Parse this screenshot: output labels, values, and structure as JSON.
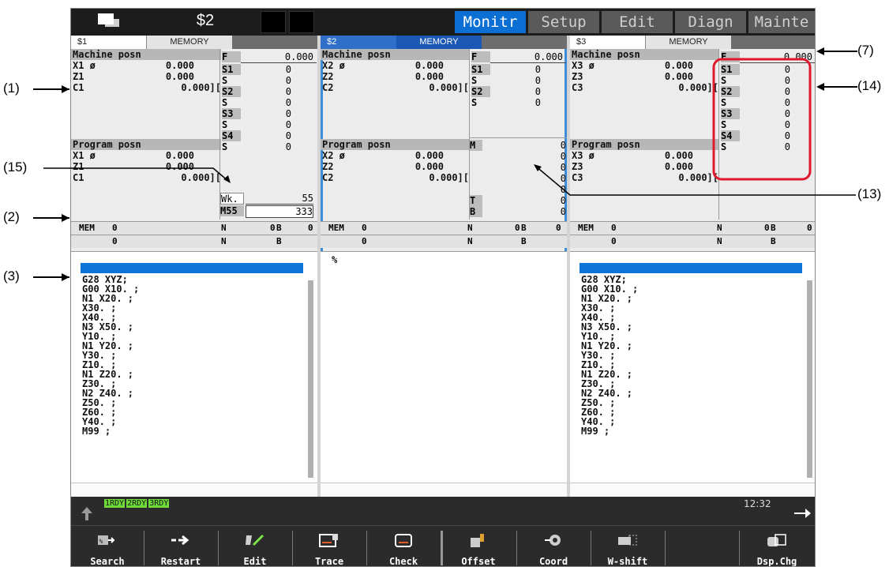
{
  "topbar": {
    "title": "$2",
    "tabs": [
      {
        "label": "Monitr",
        "active": true
      },
      {
        "label": "Setup",
        "active": false
      },
      {
        "label": "Edit",
        "active": false
      },
      {
        "label": "Diagn",
        "active": false
      },
      {
        "label": "Mainte",
        "active": false
      }
    ]
  },
  "panels": [
    {
      "system": "$1",
      "mode": "MEMORY",
      "machine_title": "Machine posn",
      "machine_axes": [
        {
          "name": "X1 ø",
          "value": "0.000"
        },
        {
          "name": "Z1",
          "value": "0.000"
        },
        {
          "name": "C1",
          "value": "0.000]["
        }
      ],
      "program_title": "Program posn",
      "program_axes": [
        {
          "name": "X1 ø",
          "value": "0.000"
        },
        {
          "name": "Z1",
          "value": "0.000"
        },
        {
          "name": "C1",
          "value": "0.000]["
        }
      ],
      "feed_label": "F",
      "feed_value": "0.000",
      "spindle": [
        {
          "label": "S1",
          "value": "0"
        },
        {
          "label": "S",
          "value": "0"
        },
        {
          "label": "S2",
          "value": "0"
        },
        {
          "label": "S",
          "value": "0"
        },
        {
          "label": "S3",
          "value": "0"
        },
        {
          "label": "S",
          "value": "0"
        },
        {
          "label": "S4",
          "value": "0"
        },
        {
          "label": "S",
          "value": "0"
        }
      ],
      "wk_label": "Wk.",
      "wk_value": "55",
      "m_label": "M55",
      "m_value": "333",
      "status": {
        "mode": "MEM",
        "o1": "0",
        "n1": "N",
        "num1": "0",
        "b1": "B",
        "bnum1": "0",
        "o2": "0",
        "n2": "N",
        "b2": "B"
      },
      "program_lines": [
        "G28 XYZ;",
        "G00 X10. ;",
        "N1 X20. ;",
        "X30. ;",
        "X40. ;",
        "N3 X50. ;",
        "Y10. ;",
        "N1 Y20. ;",
        "Y30. ;",
        "Z10. ;",
        "N1 Z20. ;",
        "Z30. ;",
        "N2 Z40. ;",
        "Z50. ;",
        "Z60. ;",
        "Y40. ;",
        "M99 ;"
      ]
    },
    {
      "system": "$2",
      "mode": "MEMORY",
      "machine_title": "Machine posn",
      "machine_axes": [
        {
          "name": "X2 ø",
          "value": "0.000"
        },
        {
          "name": "Z2",
          "value": "0.000"
        },
        {
          "name": "C2",
          "value": "0.000]["
        }
      ],
      "program_title": "Program posn",
      "program_axes": [
        {
          "name": "X2 ø",
          "value": "0.000"
        },
        {
          "name": "Z2",
          "value": "0.000"
        },
        {
          "name": "C2",
          "value": "0.000]["
        }
      ],
      "feed_label": "F",
      "feed_value": "0.000",
      "spindle": [
        {
          "label": "S1",
          "value": "0"
        },
        {
          "label": "S",
          "value": "0"
        },
        {
          "label": "S2",
          "value": "0"
        },
        {
          "label": "S",
          "value": "0"
        }
      ],
      "mtb": [
        {
          "label": "M",
          "value": "0"
        },
        {
          "label": "",
          "value": "0"
        },
        {
          "label": "",
          "value": "0"
        },
        {
          "label": "",
          "value": "0"
        },
        {
          "label": "",
          "value": "0"
        },
        {
          "label": "T",
          "value": "0"
        },
        {
          "label": "B",
          "value": "0"
        }
      ],
      "status": {
        "mode": "MEM",
        "o1": "0",
        "n1": "N",
        "num1": "0",
        "b1": "B",
        "bnum1": "0",
        "o2": "0",
        "n2": "N",
        "b2": "B"
      },
      "program_lines": [
        "%"
      ]
    },
    {
      "system": "$3",
      "mode": "MEMORY",
      "machine_title": "Machine posn",
      "machine_axes": [
        {
          "name": "X3 ø",
          "value": "0.000"
        },
        {
          "name": "Z3",
          "value": "0.000"
        },
        {
          "name": "C3",
          "value": "0.000]["
        }
      ],
      "program_title": "Program posn",
      "program_axes": [
        {
          "name": "X3 ø",
          "value": "0.000"
        },
        {
          "name": "Z3",
          "value": "0.000"
        },
        {
          "name": "C3",
          "value": "0.000]["
        }
      ],
      "feed_label": "F",
      "feed_value": "0.000",
      "spindle": [
        {
          "label": "S1",
          "value": "0"
        },
        {
          "label": "S",
          "value": "0"
        },
        {
          "label": "S2",
          "value": "0"
        },
        {
          "label": "S",
          "value": "0"
        },
        {
          "label": "S3",
          "value": "0"
        },
        {
          "label": "S",
          "value": "0"
        },
        {
          "label": "S4",
          "value": "0"
        },
        {
          "label": "S",
          "value": "0"
        }
      ],
      "status": {
        "mode": "MEM",
        "o1": "0",
        "n1": "N",
        "num1": "0",
        "b1": "B",
        "bnum1": "0",
        "o2": "0",
        "n2": "N",
        "b2": "B"
      },
      "program_lines": [
        "G28 XYZ;",
        "G00 X10. ;",
        "N1 X20. ;",
        "X30. ;",
        "X40. ;",
        "N3 X50. ;",
        "Y10. ;",
        "N1 Y20. ;",
        "Y30. ;",
        "Z10. ;",
        "N1 Z20. ;",
        "Z30. ;",
        "N2 Z40. ;",
        "Z50. ;",
        "Z60. ;",
        "Y40. ;",
        "M99 ;"
      ]
    }
  ],
  "bottom": {
    "rdy": [
      "1RDY",
      "2RDY",
      "3RDY"
    ],
    "time": "12:32"
  },
  "function_keys": [
    {
      "label": "Search",
      "icon": "search-icon"
    },
    {
      "label": "Restart",
      "icon": "restart-icon"
    },
    {
      "label": "Edit",
      "icon": "edit-icon"
    },
    {
      "label": "Trace",
      "icon": "trace-icon"
    },
    {
      "label": "Check",
      "icon": "check-icon"
    },
    {
      "label": "Offset",
      "icon": "offset-icon"
    },
    {
      "label": "Coord",
      "icon": "coord-icon"
    },
    {
      "label": "W-shift",
      "icon": "wshift-icon"
    },
    {
      "label": "",
      "icon": ""
    },
    {
      "label": "Dsp.Chg",
      "icon": "display-change-icon"
    }
  ],
  "annotations": [
    "(1)",
    "(2)",
    "(3)",
    "(7)",
    "(13)",
    "(14)",
    "(15)"
  ],
  "colors": {
    "accent": "#0b6fd4",
    "highlight": "#e0182d",
    "rdy": "#6fdc3a"
  }
}
